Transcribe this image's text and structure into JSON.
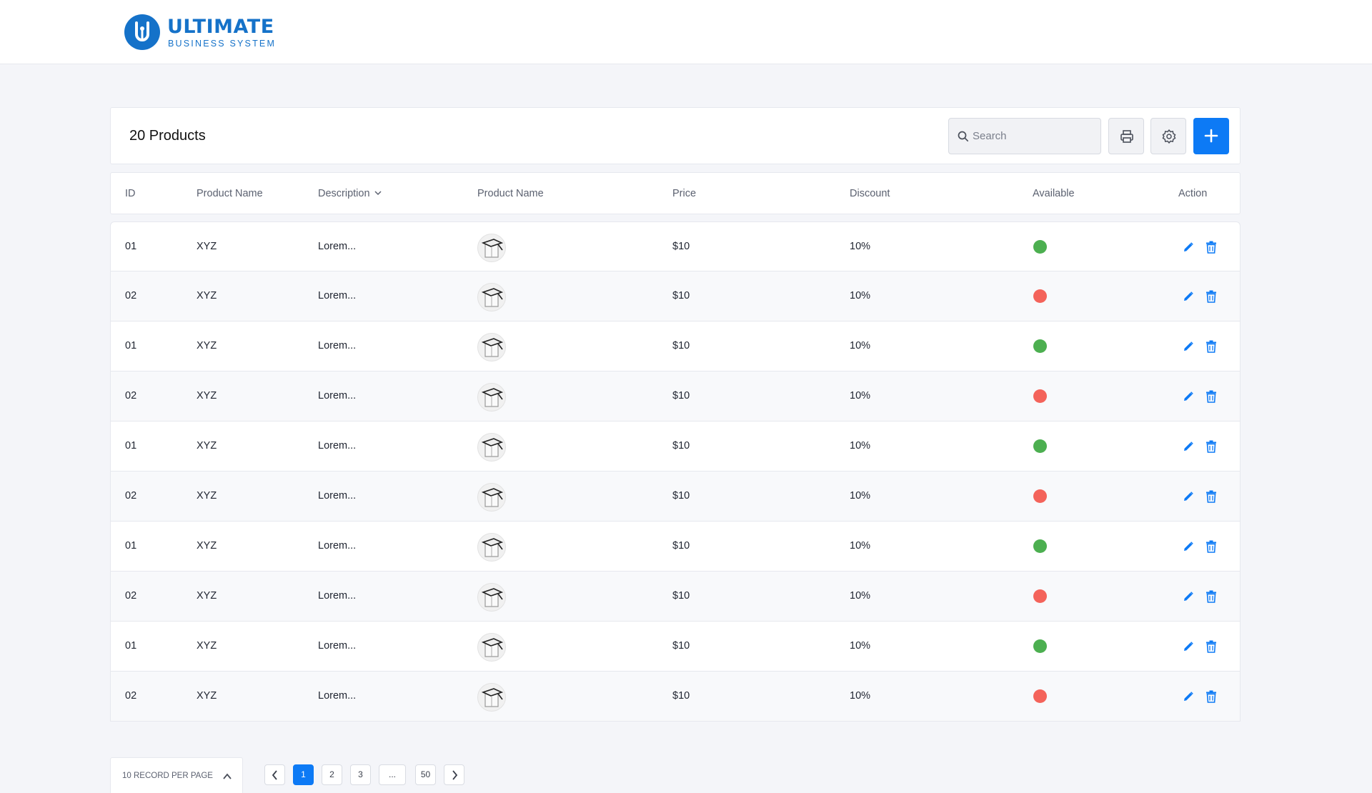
{
  "brand": {
    "title": "ULTIMATE",
    "subtitle": "BUSINESS SYSTEM",
    "color": "#1572c9"
  },
  "header": {
    "title": "20 Products"
  },
  "search": {
    "placeholder": "Search",
    "value": ""
  },
  "toolbar": {
    "print_icon": "printer-icon",
    "settings_icon": "gear-icon",
    "add_icon": "plus-icon",
    "accent": "#0d7af5"
  },
  "table": {
    "columns": [
      "ID",
      "Product Name",
      "Description",
      "Product Name",
      "Price",
      "Discount",
      "Available",
      "Action"
    ],
    "rows": [
      {
        "id": "01",
        "name": "XYZ",
        "description": "Lorem...",
        "price": "$10",
        "discount": "10%",
        "available": true
      },
      {
        "id": "02",
        "name": "XYZ",
        "description": "Lorem...",
        "price": "$10",
        "discount": "10%",
        "available": false
      },
      {
        "id": "01",
        "name": "XYZ",
        "description": "Lorem...",
        "price": "$10",
        "discount": "10%",
        "available": true
      },
      {
        "id": "02",
        "name": "XYZ",
        "description": "Lorem...",
        "price": "$10",
        "discount": "10%",
        "available": false
      },
      {
        "id": "01",
        "name": "XYZ",
        "description": "Lorem...",
        "price": "$10",
        "discount": "10%",
        "available": true
      },
      {
        "id": "02",
        "name": "XYZ",
        "description": "Lorem...",
        "price": "$10",
        "discount": "10%",
        "available": false
      },
      {
        "id": "01",
        "name": "XYZ",
        "description": "Lorem...",
        "price": "$10",
        "discount": "10%",
        "available": true
      },
      {
        "id": "02",
        "name": "XYZ",
        "description": "Lorem...",
        "price": "$10",
        "discount": "10%",
        "available": false
      },
      {
        "id": "01",
        "name": "XYZ",
        "description": "Lorem...",
        "price": "$10",
        "discount": "10%",
        "available": true
      },
      {
        "id": "02",
        "name": "XYZ",
        "description": "Lorem...",
        "price": "$10",
        "discount": "10%",
        "available": false
      }
    ]
  },
  "status_colors": {
    "available": "#4caf50",
    "unavailable": "#f4635a"
  },
  "pagination": {
    "per_page_label": "10 RECORD PER PAGE",
    "pages": [
      "1",
      "2",
      "3",
      "...",
      "50"
    ],
    "current": "1"
  }
}
